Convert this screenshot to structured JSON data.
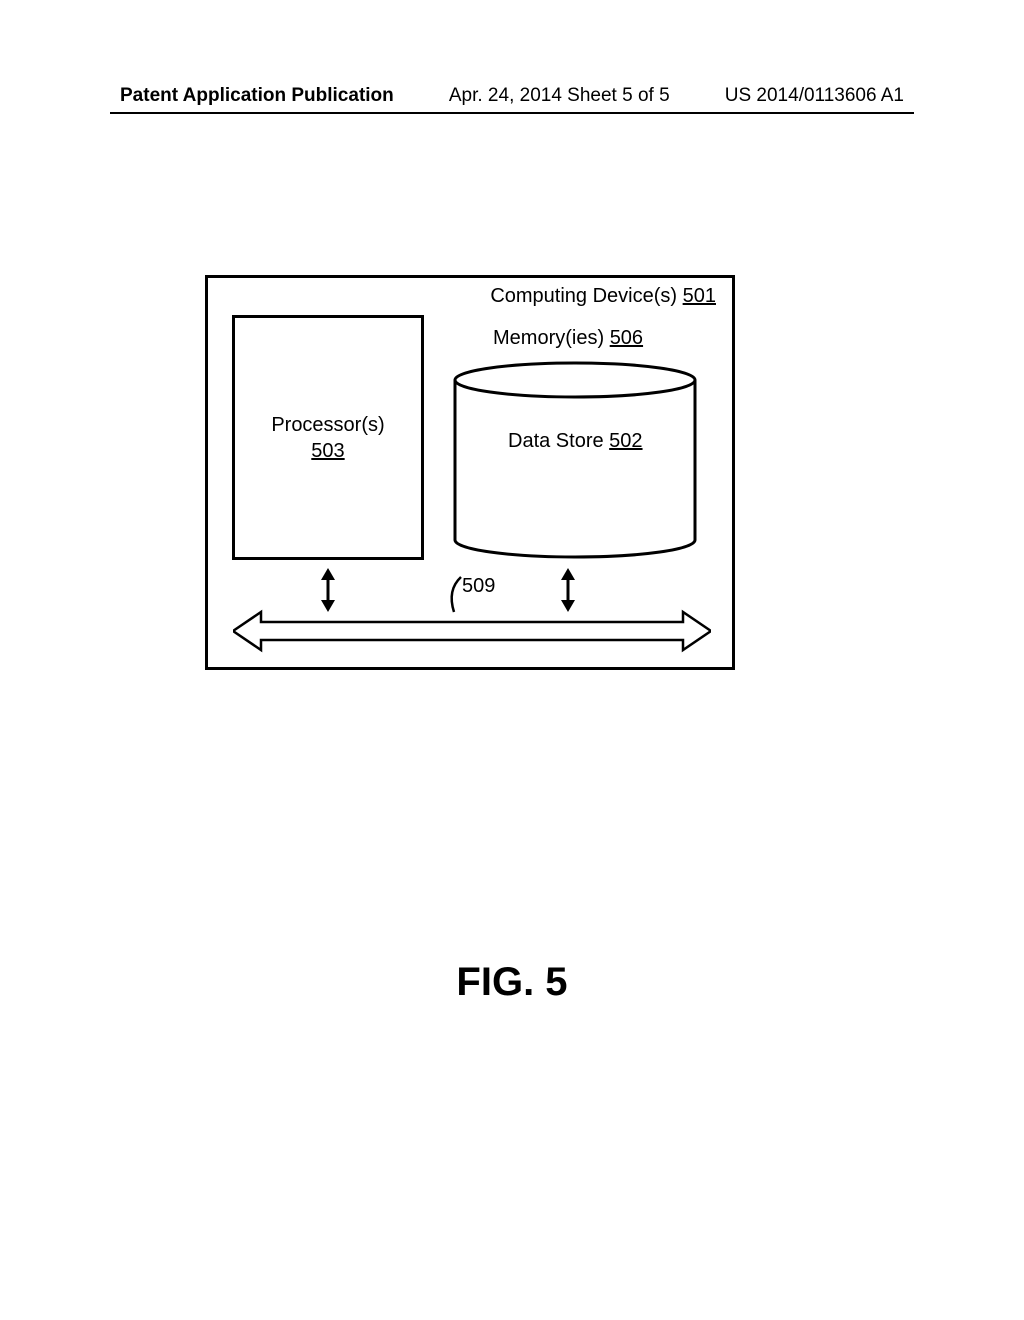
{
  "header": {
    "publication_label": "Patent Application Publication",
    "date_sheet": "Apr. 24, 2014  Sheet 5 of 5",
    "publication_number": "US 2014/0113606 A1"
  },
  "diagram": {
    "device_label_text": "Computing Device(s)",
    "device_label_ref": "501",
    "processor_label_text": "Processor(s)",
    "processor_label_ref": "503",
    "memory_label_text": "Memory(ies)",
    "memory_label_ref": "506",
    "datastore_label_text": "Data Store",
    "datastore_label_ref": "502",
    "bus_ref": "509"
  },
  "figure_caption": "FIG. 5"
}
